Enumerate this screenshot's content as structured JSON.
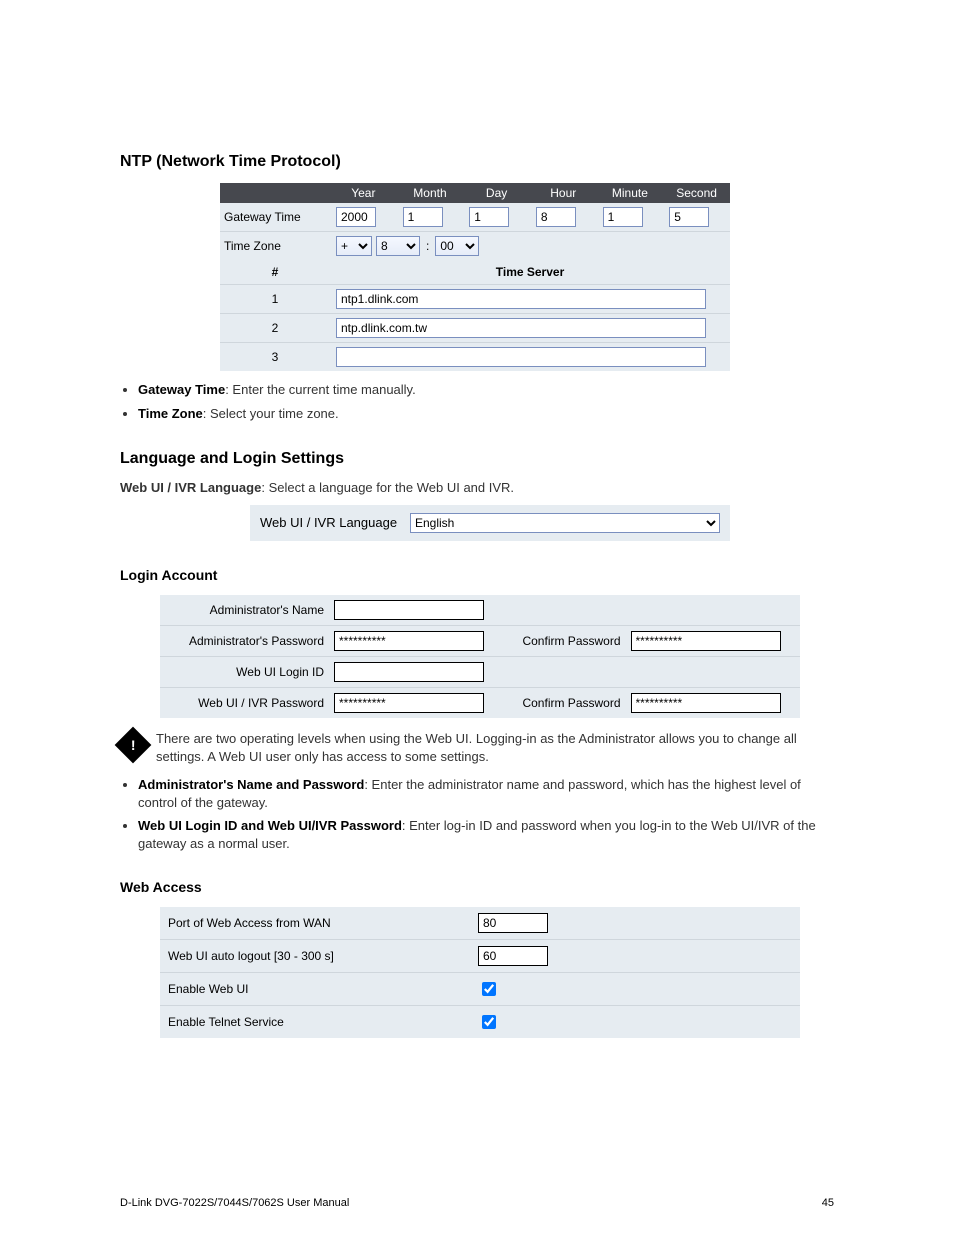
{
  "page_number_top": "45",
  "footer": {
    "product": "D-Link DVG-7022S/7044S/7062S User Manual",
    "page": "45"
  },
  "ntp": {
    "section_title": "NTP (Network Time Protocol)",
    "headers": [
      "Year",
      "Month",
      "Day",
      "Hour",
      "Minute",
      "Second"
    ],
    "rows": {
      "gateway_time_label": "Gateway Time",
      "gateway_time_values": {
        "year": "2000",
        "month": "1",
        "day": "1",
        "hour": "8",
        "minute": "1",
        "second": "5"
      },
      "time_zone_label": "Time Zone",
      "time_zone": {
        "sign": "+",
        "hour": "8",
        "minute": "00"
      },
      "server_hash": "#",
      "server_header": "Time Server",
      "servers": [
        {
          "n": "1",
          "value": "ntp1.dlink.com"
        },
        {
          "n": "2",
          "value": "ntp.dlink.com.tw"
        },
        {
          "n": "3",
          "value": ""
        }
      ]
    },
    "bullets": [
      {
        "term": "Gateway Time",
        "text": ": Enter the current time manually."
      },
      {
        "term": "Time Zone",
        "text": ": Select your time zone."
      }
    ]
  },
  "language": {
    "title": "Language and Login Settings",
    "label": "Web UI / IVR Language",
    "selected": "English",
    "desc_term": "Web UI / IVR Language",
    "desc_text": ": Select a language for the Web UI and IVR."
  },
  "login": {
    "subtitle": "Login Account",
    "labels": {
      "admin_name": "Administrator's Name",
      "admin_pass": "Administrator's Password",
      "confirm": "Confirm Password",
      "web_id": "Web UI Login ID",
      "web_pass": "Web UI / IVR Password"
    },
    "values": {
      "admin_name": "",
      "admin_pass": "**********",
      "admin_confirm": "**********",
      "web_id": "",
      "web_pass": "**********",
      "web_confirm": "**********"
    },
    "warning": "There are two operating levels when using the Web UI. Logging-in as the Administrator allows you to change all settings. A Web UI user only has access to some settings.",
    "bullets": [
      {
        "term": "Administrator's Name and Password",
        "text": ": Enter the administrator name and password, which has the highest level of control of the gateway."
      },
      {
        "term": "Web UI Login ID and Web UI/IVR Password",
        "text": ": Enter log-in ID and password when you log-in to the Web UI/IVR of the gateway as a normal user."
      }
    ]
  },
  "access": {
    "subtitle": "Web Access",
    "labels": {
      "port": "Port of Web Access from WAN",
      "logout": "Web UI auto logout [30 - 300 s]",
      "enable_web": "Enable Web UI",
      "enable_telnet": "Enable Telnet Service"
    },
    "values": {
      "port": "80",
      "logout": "60",
      "enable_web_checked": true,
      "enable_telnet_checked": true
    }
  }
}
